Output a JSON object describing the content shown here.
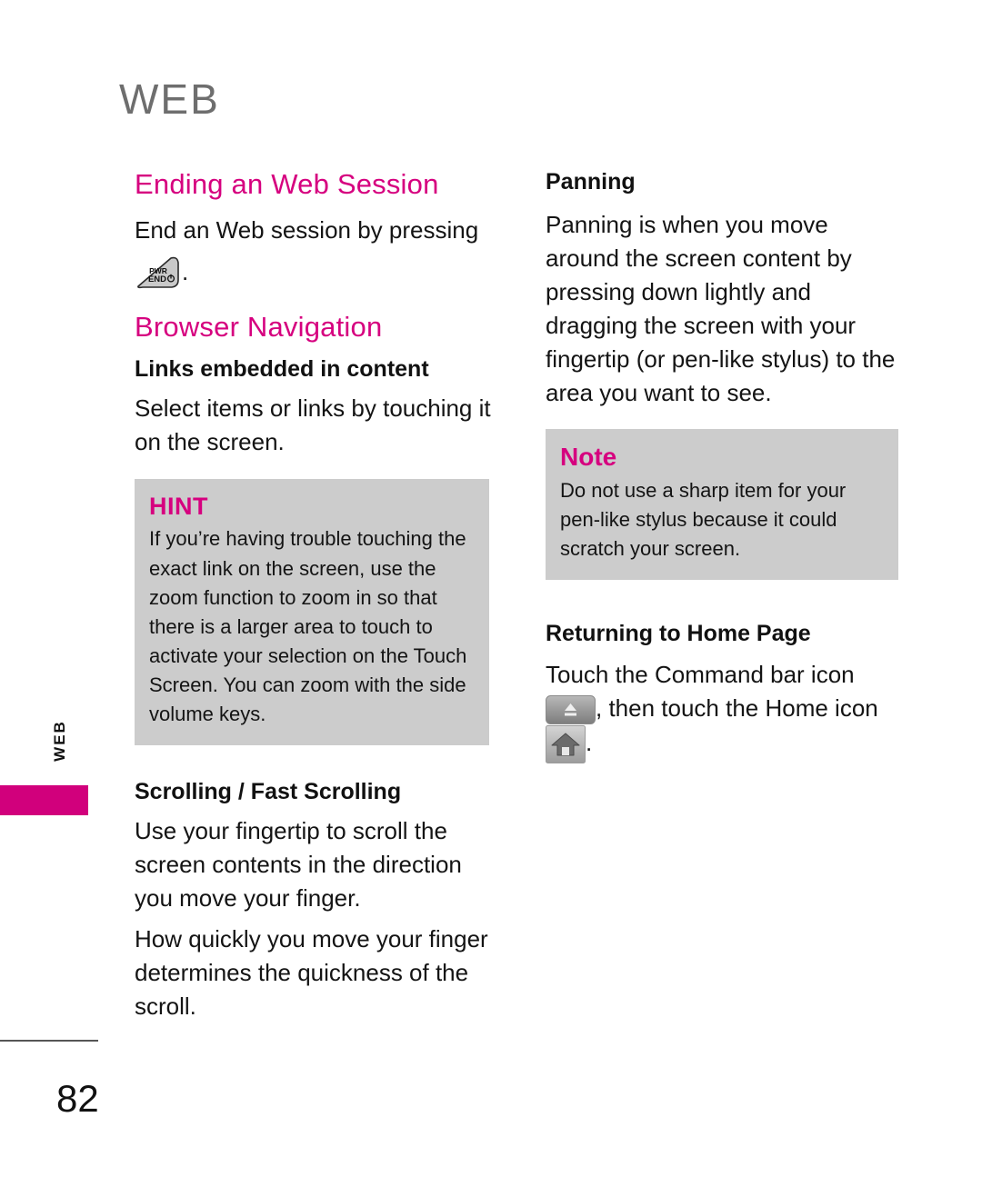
{
  "page": {
    "header_title": "WEB",
    "side_tab_label": "WEB",
    "page_number": "82",
    "accent_color": "#D6007F",
    "header_color": "#6E6E6E",
    "callout_bg_color": "#CCCCCC",
    "side_bar_color": "#D1007C"
  },
  "left_column": {
    "ending_session": {
      "title": "Ending an Web Session",
      "text_before_icon": "End an Web session by pressing",
      "key_icon_label_top": "PWR",
      "key_icon_label_bottom": "END",
      "text_after_icon": "."
    },
    "browser_navigation": {
      "title": "Browser Navigation",
      "links_embedded": {
        "subtitle": "Links embedded in content",
        "body": "Select items or links by touching it on the screen."
      },
      "hint_box": {
        "label": "HINT",
        "text": "If you’re having trouble touching the exact link on the screen, use the zoom function to zoom in so that there is a larger area to touch to activate your selection on the Touch Screen. You can zoom with the side volume keys."
      },
      "scrolling": {
        "subtitle": "Scrolling / Fast Scrolling",
        "paragraph_1": "Use your fingertip to scroll the screen contents in the direction you move your finger.",
        "paragraph_2": "How quickly you move your finger determines the quickness of the scroll."
      }
    }
  },
  "right_column": {
    "panning": {
      "subtitle": "Panning",
      "body": "Panning is when you move around the screen content by pressing down lightly and dragging the screen with your fingertip (or pen-like stylus) to the area you want to see."
    },
    "note_box": {
      "label": "Note",
      "text": "Do not use a sharp item for your pen-like stylus because it could scratch your screen."
    },
    "returning_home": {
      "subtitle": "Returning to Home Page",
      "text_line_1": "Touch the Command bar icon",
      "text_line_2": ", then touch the Home icon",
      "text_line_3": "."
    }
  }
}
